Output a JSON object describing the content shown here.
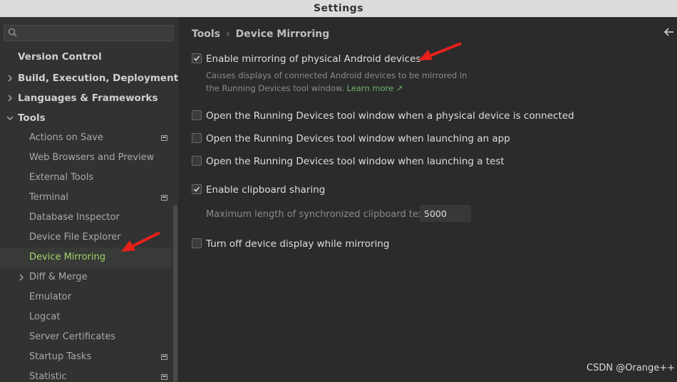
{
  "window": {
    "title": "Settings"
  },
  "search": {
    "placeholder": "",
    "value": ""
  },
  "sidebar": {
    "items": [
      {
        "label": "Version Control"
      },
      {
        "label": "Build, Execution, Deployment"
      },
      {
        "label": "Languages & Frameworks"
      },
      {
        "label": "Tools"
      },
      {
        "label": "Actions on Save"
      },
      {
        "label": "Web Browsers and Preview"
      },
      {
        "label": "External Tools"
      },
      {
        "label": "Terminal"
      },
      {
        "label": "Database Inspector"
      },
      {
        "label": "Device File Explorer"
      },
      {
        "label": "Device Mirroring"
      },
      {
        "label": "Diff & Merge"
      },
      {
        "label": "Emulator"
      },
      {
        "label": "Logcat"
      },
      {
        "label": "Server Certificates"
      },
      {
        "label": "Startup Tasks"
      },
      {
        "label": "Statistic"
      }
    ]
  },
  "breadcrumb": {
    "parent": "Tools",
    "current": "Device Mirroring"
  },
  "options": {
    "enable_mirroring": {
      "label": "Enable mirroring of physical Android devices",
      "checked": true
    },
    "mirroring_desc_line1": "Causes displays of connected Android devices to be mirrored in",
    "mirroring_desc_line2": "the Running Devices tool window.",
    "learn_more": "Learn more ↗",
    "open_on_connect": {
      "label": "Open the Running Devices tool window when a physical device is connected",
      "checked": false
    },
    "open_on_app": {
      "label": "Open the Running Devices tool window when launching an app",
      "checked": false
    },
    "open_on_test": {
      "label": "Open the Running Devices tool window when launching a test",
      "checked": false
    },
    "clipboard_sharing": {
      "label": "Enable clipboard sharing",
      "checked": true
    },
    "clipboard_max_label": "Maximum length of synchronized clipboard text:",
    "clipboard_max_value": "5000",
    "turn_off_display": {
      "label": "Turn off device display while mirroring",
      "checked": false
    }
  },
  "watermark": "CSDN @Orange++",
  "colors": {
    "selected_text": "#a4d16b",
    "link": "#6fb36f",
    "annotation_arrow": "#e8201a"
  }
}
